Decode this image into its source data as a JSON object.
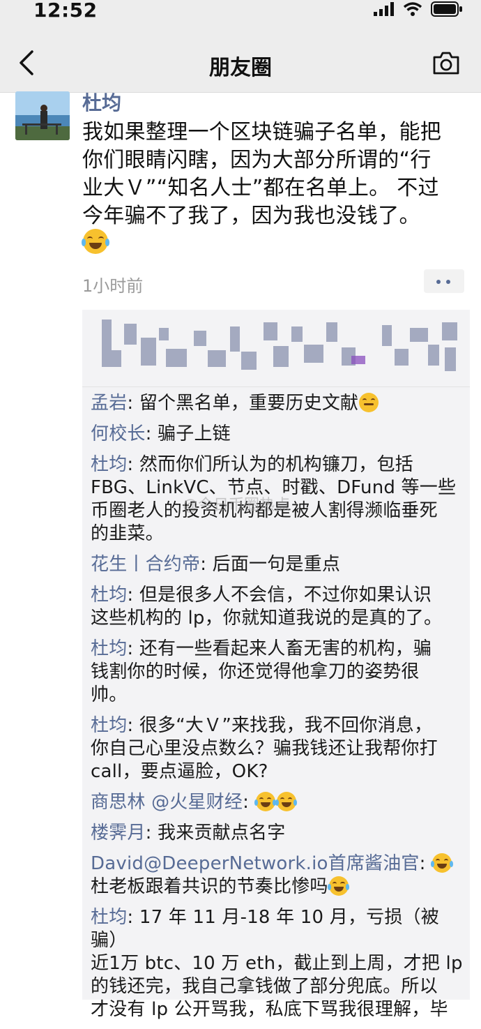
{
  "status_bar": {
    "time": "12:52"
  },
  "nav": {
    "title": "朋友圈"
  },
  "post": {
    "author": "杜均",
    "lines": [
      "我如果整理一个区块链骗子名单，能把",
      "你们眼睛闪瞎，因为大部分所谓的“行",
      "业大Ｖ”“知名人士”都在名单上。 不过",
      "今年骗不了我了，因为我也没钱了。"
    ],
    "time": "1小时前"
  },
  "comments": [
    {
      "name": "孟岩",
      "sep": ": ",
      "lines": [
        "留个黑名单，重要历史文献"
      ],
      "trail": "🤔"
    },
    {
      "name": "何校长",
      "sep": ": ",
      "lines": [
        "骗子上链"
      ]
    },
    {
      "name": "杜均",
      "sep": ": ",
      "lines": [
        "然而你们所认为的机构镰刀，包括",
        "FBG、LinkVC、节点、时戳、DFund 等一些",
        "币圈老人的投资机构都是被人割得濒临垂死",
        "的韭菜。"
      ]
    },
    {
      "name": "花生丨合约帝",
      "sep": ": ",
      "lines": [
        "后面一句是重点"
      ]
    },
    {
      "name": "杜均",
      "sep": ": ",
      "lines": [
        "但是很多人不会信，不过你如果认识",
        "这些机构的 lp，你就知道我说的是真的了。"
      ]
    },
    {
      "name": "杜均",
      "sep": ": ",
      "lines": [
        "还有一些看起来人畜无害的机构，骗",
        "钱割你的时候，你还觉得他拿刀的姿势很",
        "帅。"
      ]
    },
    {
      "name": "杜均",
      "sep": ": ",
      "lines": [
        "很多“大Ｖ”来找我，我不回你消息，",
        "你自己心里没点数么？骗我钱还让我帮你打",
        "call，要点逼脸，OK?"
      ]
    },
    {
      "name": "商思林 @火星财经",
      "sep": ": ",
      "lines": [
        ""
      ],
      "trail": "😂😂"
    },
    {
      "name": "楼霁月",
      "sep": ": ",
      "lines": [
        "我来贡献点名字"
      ]
    },
    {
      "name": "David@DeeperNetwork.io首席酱油官",
      "sep": ": ",
      "lines": [
        "",
        "杜老板跟着共识的节奏比惨吗"
      ],
      "trail": "😂"
    },
    {
      "name": "杜均",
      "sep": ": ",
      "lines": [
        "17 年 11 月-18 年 10 月，亏损（被骗）",
        "近1万 btc、10 万 eth，截止到上周，才把 lp",
        "的钱还完，我自己拿钱做了部分兜底。所以",
        "才没有 lp 公开骂我，私底下骂我很理解，毕"
      ]
    }
  ],
  "watermark": "@今日币圈热点",
  "icons": [
    "back-icon",
    "camera-icon",
    "signal-icon",
    "wifi-icon",
    "battery-icon",
    "more-icon",
    "laugh-emoji-icon"
  ]
}
